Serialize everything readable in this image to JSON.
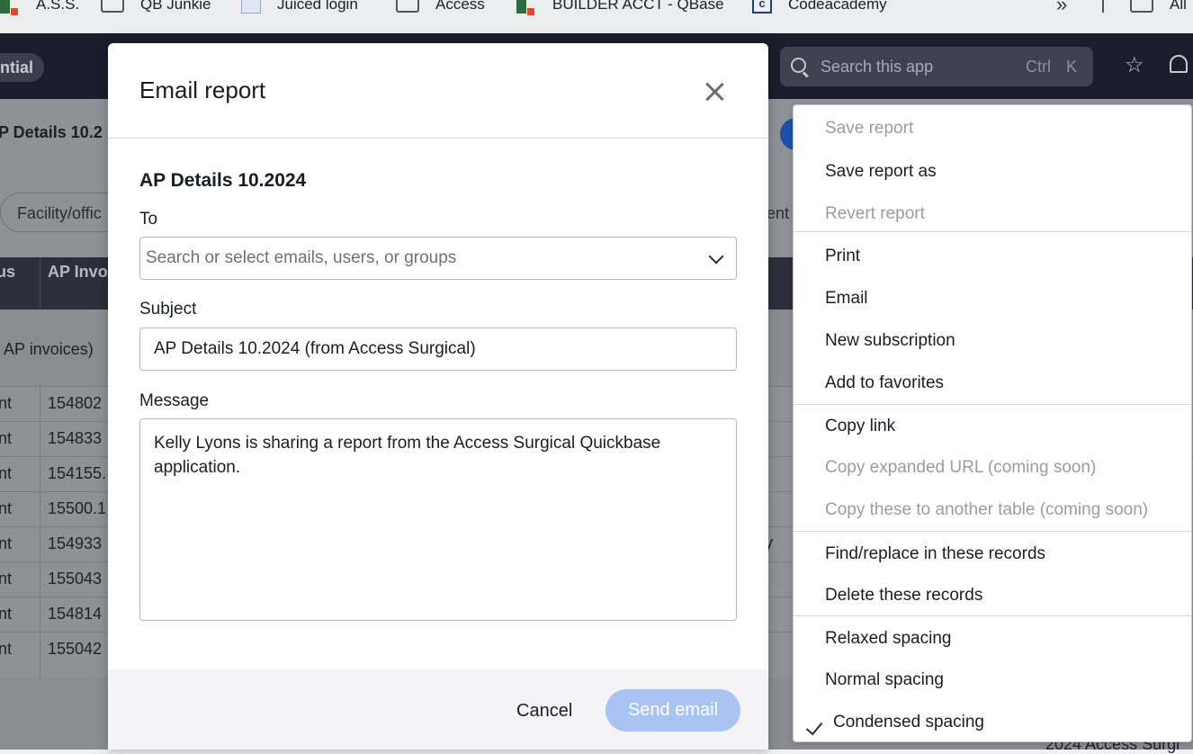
{
  "bookmarks": [
    {
      "label": "A.S.S.",
      "icon": "quickbase-icon"
    },
    {
      "label": "QB Junkie",
      "icon": "folder-icon"
    },
    {
      "label": "Juiced login",
      "icon": "juiced-icon"
    },
    {
      "label": "Access",
      "icon": "folder-icon"
    },
    {
      "label": "BUILDER ACCT - QBase",
      "icon": "quickbase-icon"
    },
    {
      "label": "Codeacademy",
      "icon": "codeacademy-icon"
    },
    {
      "label": "All",
      "icon": "folder-icon"
    }
  ],
  "app": {
    "env_pill": "ntial",
    "search_placeholder": "Search this app",
    "search_kbd": [
      "Ctrl",
      "K"
    ],
    "report_title": "P Details 10.2",
    "filter_chip": "Facility/offic",
    "filter_tail": "ent",
    "table_headers": [
      "us",
      "AP Invo"
    ],
    "group_text": "AP invoices)",
    "rows": [
      {
        "c1": "nt",
        "c2": "154802"
      },
      {
        "c1": "nt",
        "c2": "154833"
      },
      {
        "c1": "nt",
        "c2": "154155."
      },
      {
        "c1": "nt",
        "c2": "15500.1"
      },
      {
        "c1": "nt",
        "c2": "154933"
      },
      {
        "c1": "nt",
        "c2": "155043"
      },
      {
        "c1": "nt",
        "c2": "154814"
      },
      {
        "c1": "nt",
        "c2": "155042"
      }
    ],
    "side_fragment": "y",
    "footer_fragment": "2024 Access Surgi"
  },
  "modal": {
    "title": "Email report",
    "report_name": "AP Details 10.2024",
    "to_label": "To",
    "to_placeholder": "Search or select emails, users, or groups",
    "subject_label": "Subject",
    "subject_value": "AP Details 10.2024 (from Access Surgical)",
    "message_label": "Message",
    "message_value": "Kelly Lyons is sharing a report from the Access Surgical Quickbase application.",
    "cancel_label": "Cancel",
    "send_label": "Send email",
    "send_color": "#a9c4f2"
  },
  "menu": {
    "items": [
      {
        "label": "Save report",
        "disabled": true
      },
      {
        "label": "Save report as",
        "disabled": false
      },
      {
        "label": "Revert report",
        "disabled": true
      },
      {
        "label": "Print",
        "disabled": false
      },
      {
        "label": "Email",
        "disabled": false
      },
      {
        "label": "New subscription",
        "disabled": false
      },
      {
        "label": "Add to favorites",
        "disabled": false
      },
      {
        "label": "Copy link",
        "disabled": false
      },
      {
        "label": "Copy expanded URL (coming soon)",
        "disabled": true
      },
      {
        "label": "Copy these to another table (coming soon)",
        "disabled": true
      },
      {
        "label": "Find/replace in these records",
        "disabled": false
      },
      {
        "label": "Delete these records",
        "disabled": false
      },
      {
        "label": "Relaxed spacing",
        "disabled": false
      },
      {
        "label": "Normal spacing",
        "disabled": false
      },
      {
        "label": "Condensed spacing",
        "disabled": false,
        "checked": true
      }
    ]
  }
}
